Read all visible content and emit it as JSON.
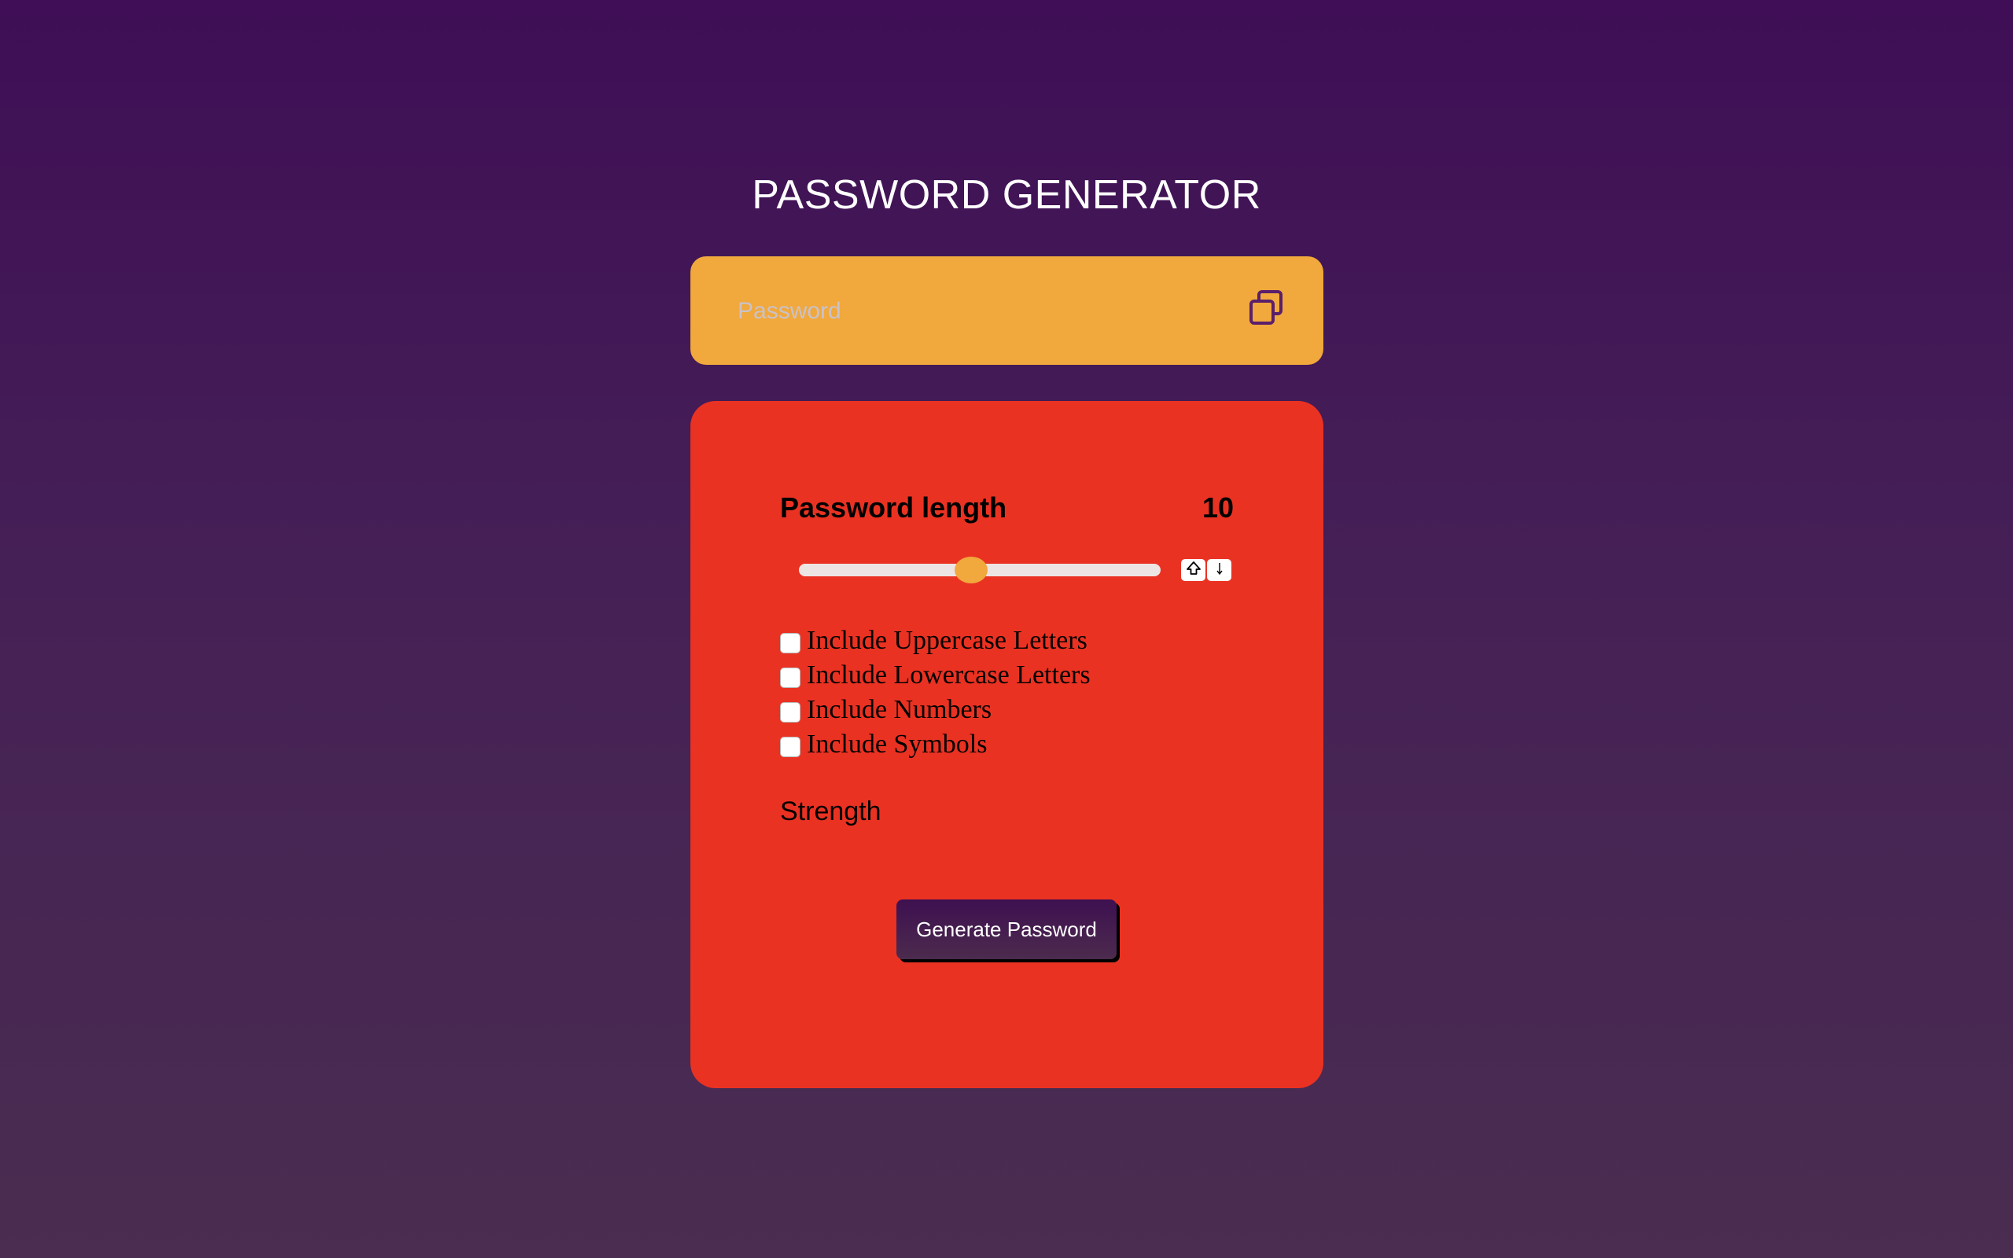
{
  "header": {
    "title": "PASSWORD GENERATOR"
  },
  "password": {
    "placeholder": "Password",
    "value": "",
    "copy_icon": "copy-icon"
  },
  "settings": {
    "length_label": "Password length",
    "length_value": "10",
    "slider": {
      "min": 0,
      "max": 20,
      "value": 10
    },
    "options": [
      {
        "label": "Include Uppercase Letters",
        "checked": false
      },
      {
        "label": "Include Lowercase Letters",
        "checked": false
      },
      {
        "label": "Include Numbers",
        "checked": false
      },
      {
        "label": "Include Symbols",
        "checked": false
      }
    ],
    "strength_label": "Strength",
    "generate_label": "Generate Password"
  },
  "colors": {
    "background_top": "#3f0e56",
    "background_bottom": "#4a2d50",
    "password_box": "#f1a83c",
    "panel": "#ea3222",
    "accent": "#f1a83c",
    "button": "#3e1050"
  }
}
